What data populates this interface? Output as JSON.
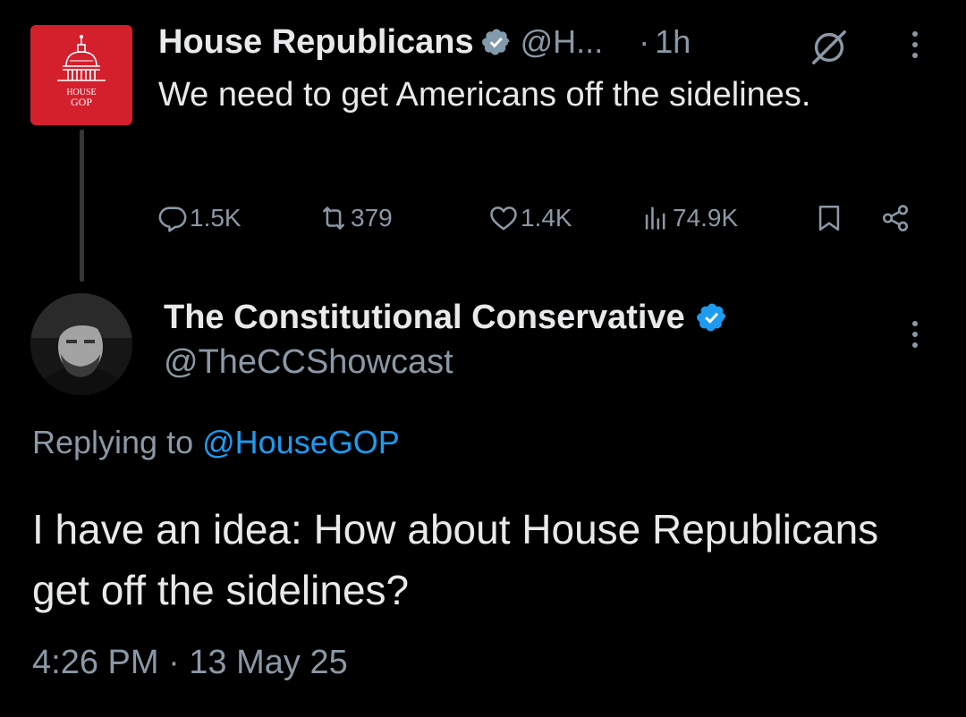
{
  "parent_tweet": {
    "author_name": "House Republicans",
    "handle": "@H...",
    "separator": "·",
    "time_ago": "1h",
    "text": "We need to get Americans off the sidelines.",
    "avatar_text": {
      "line1": "HOUSE",
      "line2": "GOP"
    },
    "stats": {
      "replies": "1.5K",
      "reposts": "379",
      "likes": "1.4K",
      "views": "74.9K"
    },
    "icons": [
      "verified-grey-badge",
      "grok-icon",
      "more-icon",
      "reply-icon",
      "repost-icon",
      "like-icon",
      "views-icon",
      "bookmark-icon",
      "share-icon"
    ]
  },
  "reply_tweet": {
    "author_name": "The Constitutional Conservative",
    "handle": "@TheCCShowcast",
    "replying_prefix": "Replying to ",
    "replying_mention": "@HouseGOP",
    "text": "I have an idea: How about House Republicans get off the sidelines?",
    "timestamp": "4:26 PM · 13 May 25",
    "icons": [
      "verified-blue-badge",
      "more-icon"
    ]
  },
  "colors": {
    "background": "#000000",
    "text_primary": "#e7e9ea",
    "text_secondary": "#8b98a5",
    "accent": "#1d9bf0",
    "gop_red": "#d41f2d",
    "verified_grey": "#829aab"
  }
}
